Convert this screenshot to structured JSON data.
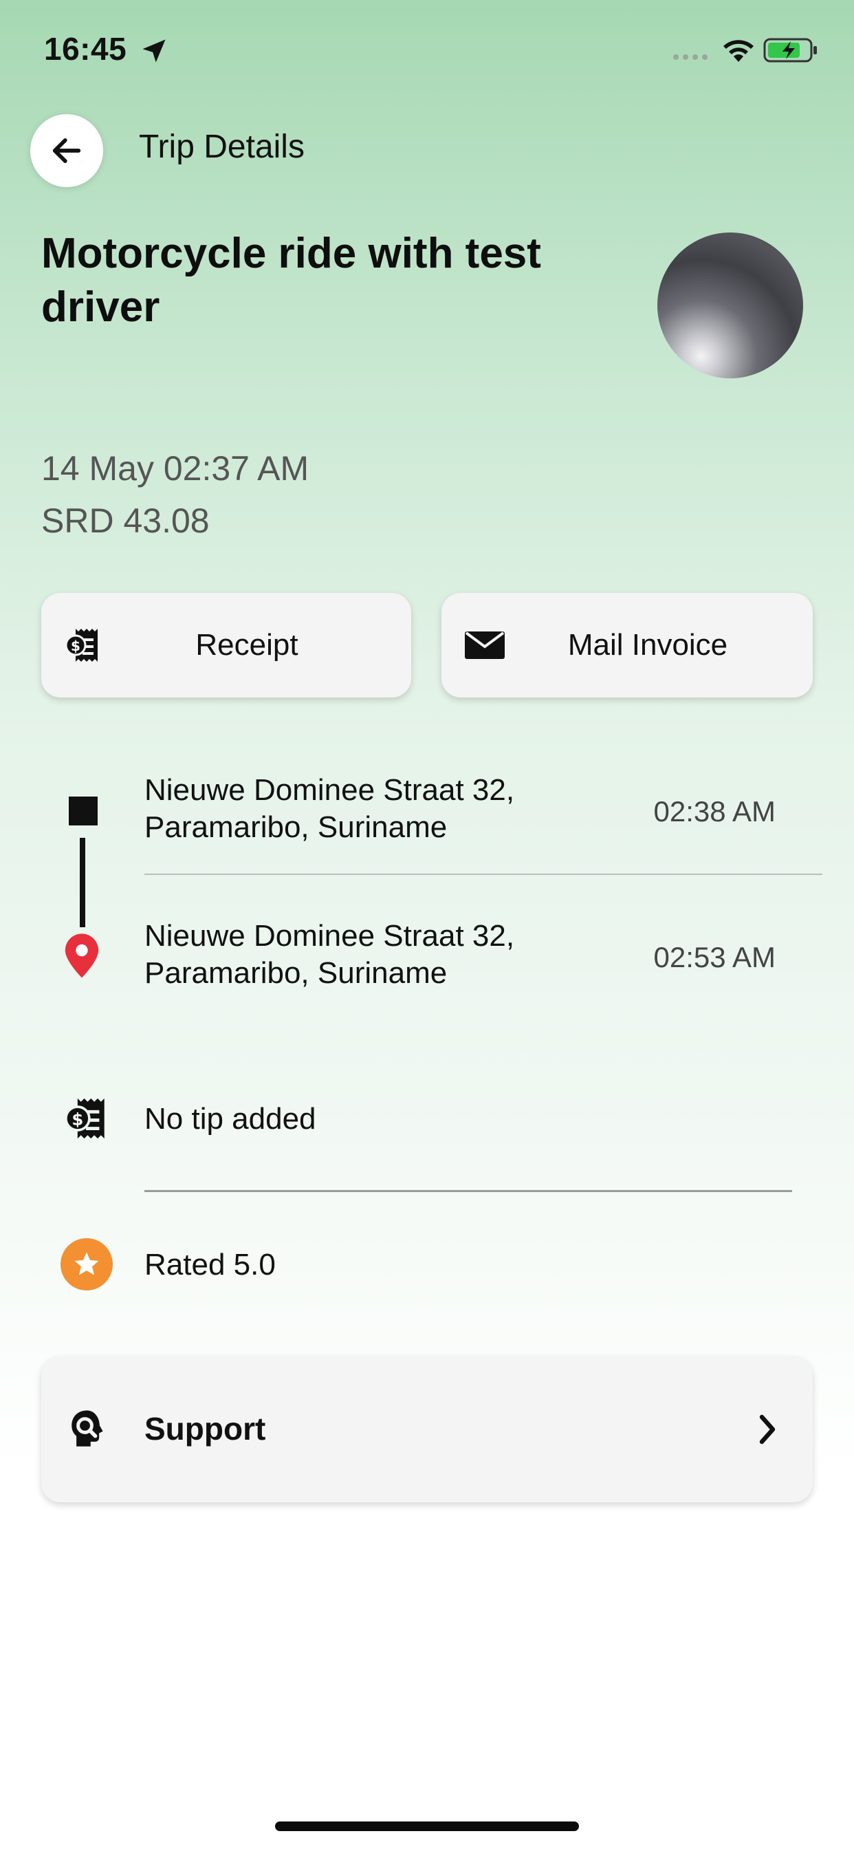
{
  "status_bar": {
    "time": "16:45"
  },
  "header": {
    "title": "Trip Details"
  },
  "trip": {
    "title": "Motorcycle ride with test driver",
    "date": "14 May 02:37 AM",
    "fare": "SRD 43.08"
  },
  "actions": {
    "receipt_label": "Receipt",
    "mail_invoice_label": "Mail Invoice"
  },
  "route": {
    "pickup": {
      "address": "Nieuwe Dominee Straat 32, Paramaribo, Suriname",
      "time": "02:38 AM"
    },
    "dropoff": {
      "address": "Nieuwe Dominee Straat 32, Paramaribo, Suriname",
      "time": "02:53 AM"
    }
  },
  "tip": {
    "label": "No tip added"
  },
  "rating": {
    "label": "Rated 5.0"
  },
  "support": {
    "label": "Support"
  },
  "colors": {
    "accent_star": "#f39032",
    "pin": "#e8303c",
    "background_top": "#a6d8b3"
  },
  "icons": {
    "back": "arrow-left-icon",
    "receipt": "receipt-icon",
    "mail": "envelope-icon",
    "pickup": "square-stop-icon",
    "dropoff": "map-pin-icon",
    "tip": "receipt-icon",
    "rating": "star-icon",
    "support": "support-agent-icon",
    "chevron": "chevron-right-icon"
  }
}
